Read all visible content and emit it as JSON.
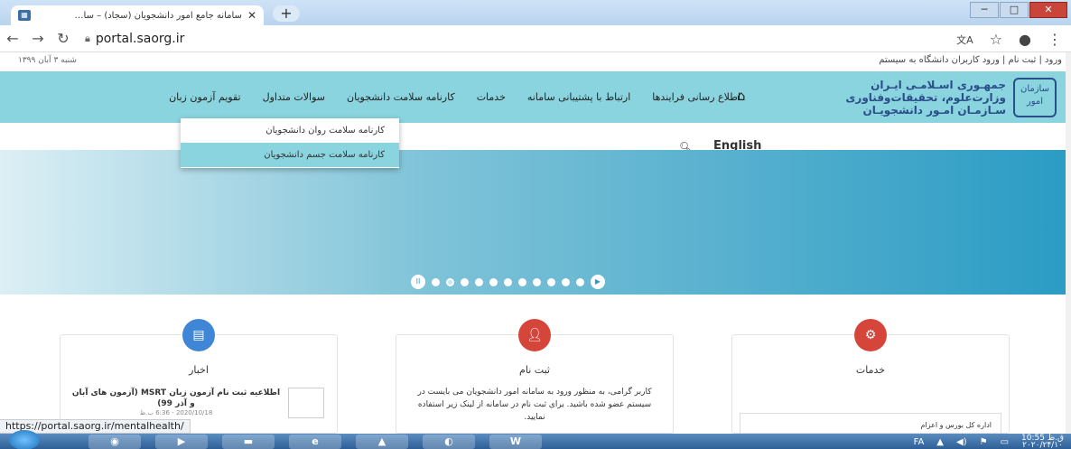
{
  "browser": {
    "tab_title": "سامانه جامع امور دانشجویان (سجاد) – سا…",
    "tab_close": "✕",
    "newtab": "+",
    "url": "portal.saorg.ir",
    "status_url": "https://portal.saorg.ir/mentalhealth/"
  },
  "topstrip": {
    "date": "شنبه ۳ آبان ۱۳۹۹",
    "links": "ورود  |  ثبت نام  |  ورود کاربران دانشگاه به سیستم"
  },
  "logo": {
    "line1": "جمهـوری اسـلامـی ایـران",
    "line2": "وزارت‌علوم، تحقیقات‌وفناوری",
    "line3": "سـازمـان امـور دانشجویـان"
  },
  "nav": {
    "items": [
      "اطلاع رسانی فرایندها",
      "ارتباط با پشتیبانی سامانه",
      "خدمات",
      "کارنامه سلامت دانشجویان",
      "سوالات متداول",
      "تقویم آزمون زبان"
    ]
  },
  "subbar": {
    "english": "English"
  },
  "dropdown": {
    "items": [
      "کارنامه سلامت روان دانشجویان",
      "کارنامه سلامت جسم دانشجویان"
    ]
  },
  "cards": {
    "news": {
      "title": "اخبار",
      "item_title": "اطلاعیه ثبت نام آزمون زبان MSRT (آزمون های آبان و آذر 99)",
      "item_date": "2020/10/18 - 6:36 ب.ظ"
    },
    "register": {
      "title": "ثبت نام",
      "text": "کاربر گرامی، به منظور ورود به سامانه امور دانشجویان می بایست در سیستم عضو شده باشید. برای ثبت نام در سامانه از لینک زیر استفاده نمایید."
    },
    "services": {
      "title": "خدمات",
      "item": "اداره کل بورس و اعزام"
    }
  },
  "taskbar": {
    "lang": "FA",
    "time": "10:55 ق.ظ",
    "date": "۲۰۲۰/۲۴/۱۰"
  }
}
